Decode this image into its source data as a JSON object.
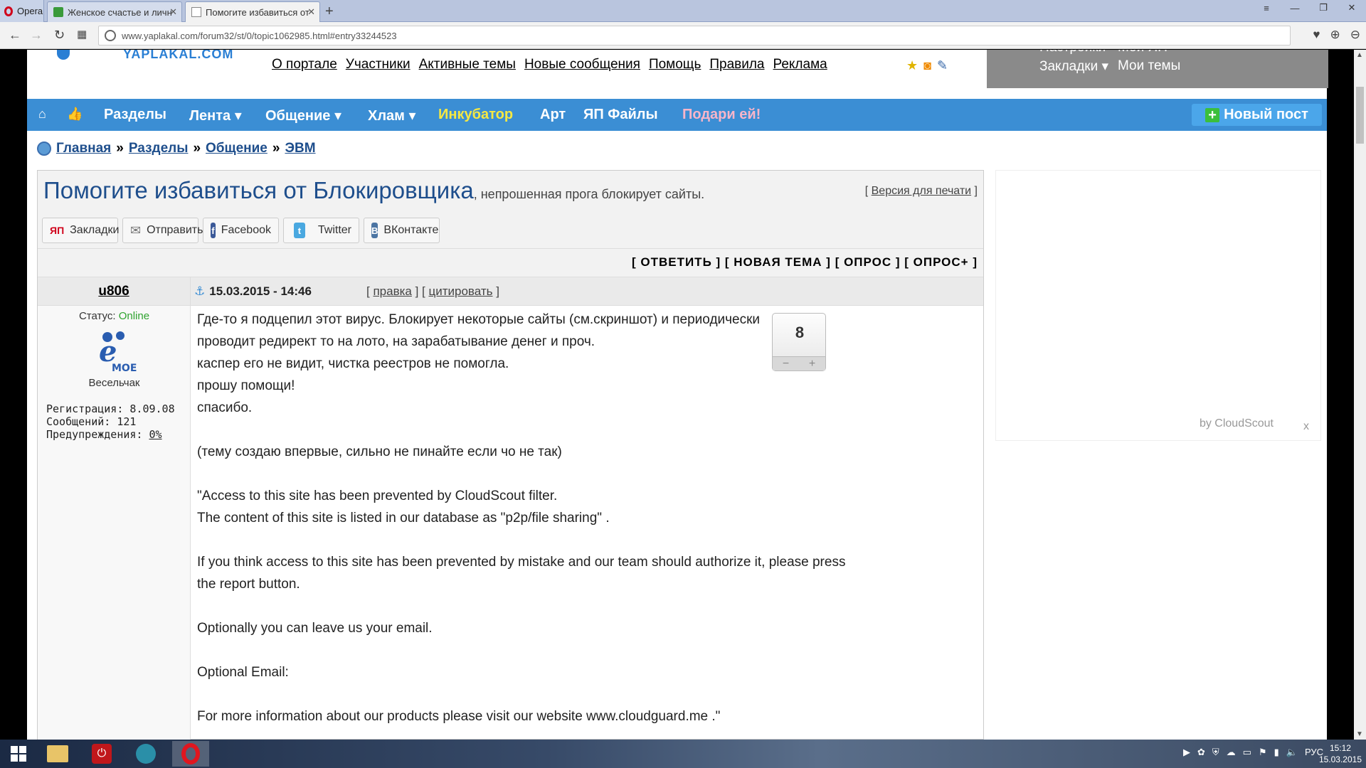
{
  "browser": {
    "opera_label": "Opera",
    "tabs": [
      {
        "title": "Женское счастье и личн"
      },
      {
        "title": "Помогите избавиться от"
      }
    ],
    "url": "www.yaplakal.com/forum32/st/0/topic1062985.html#entry33244523"
  },
  "site": {
    "logo_text": "YAPLAKAL.COM",
    "top_links": [
      "О портале",
      "Участники",
      "Активные темы",
      "Новые сообщения",
      "Помощь",
      "Правила",
      "Реклама"
    ],
    "user_menu": {
      "settings": "Настройки",
      "bookmarks": "Закладки ▾",
      "my_topics": "Мои темы",
      "extra": "Мой ЯП"
    },
    "nav": [
      {
        "label": "Разделы",
        "color": "#ffffff"
      },
      {
        "label": "Лента ▾",
        "color": "#ffffff"
      },
      {
        "label": "Общение ▾",
        "color": "#ffffff"
      },
      {
        "label": "Хлам ▾",
        "color": "#ffffff"
      },
      {
        "label": "Инкубатор",
        "color": "#f6e842"
      },
      {
        "label": "Арт",
        "color": "#ffffff"
      },
      {
        "label": "ЯП Файлы",
        "color": "#ffffff"
      },
      {
        "label": "Подари ей!",
        "color": "#f7b5c9"
      }
    ],
    "new_post": "Новый пост"
  },
  "breadcrumb": [
    "Главная",
    "Разделы",
    "Общение",
    "ЭВМ"
  ],
  "breadcrumb_sep": "»",
  "topic": {
    "title": "Помогите избавиться от Блокировщика",
    "subtitle": ", непрошенная прога блокирует сайты.",
    "print_link": "Версия для печати",
    "shares": [
      "Закладки",
      "Отправить",
      "Facebook",
      "Twitter",
      "ВКонтакте"
    ],
    "actions": "[ ОТВЕТИТЬ ] [ НОВАЯ ТЕМА ] [ ОПРОС ] [ ОПРОС+ ]"
  },
  "post": {
    "author": "u806",
    "date": "15.03.2015 - 14:46",
    "edit": "правка",
    "quote": "цитировать",
    "status_label": "Статус:",
    "status_value": "Online",
    "rank": "Весельчак",
    "reg": "Регистрация: 8.09.08",
    "messages": "Сообщений: 121",
    "warnings_label": "Предупреждения:",
    "warnings_value": "0%",
    "rating": "8",
    "lines": [
      "Где-то я подцепил этот вирус. Блокирует некоторые сайты (см.скриншот) и периодически",
      "проводит редирект то на лото, на зарабатывание денег и проч.",
      "каспер его не видит, чистка реестров не помогла.",
      "прошу помощи!",
      "спасибо.",
      "",
      "(тему создаю впервые, сильно не пинайте если чо не так)",
      "",
      "\"Access to this site has been prevented by CloudScout filter.",
      "The content of this site is listed in our database as \"p2p/file sharing\" .",
      "",
      "If you think access to this site has been prevented by mistake and our team should authorize it, please press",
      "the report button.",
      "",
      "Optionally you can leave us your email.",
      "",
      "Optional Email:",
      "",
      "For more information about our products please visit our website www.cloudguard.me .\""
    ]
  },
  "ad": {
    "by": "by CloudScout",
    "close": "x"
  },
  "taskbar": {
    "lang": "РУС",
    "time": "15:12",
    "date": "15.03.2015"
  }
}
